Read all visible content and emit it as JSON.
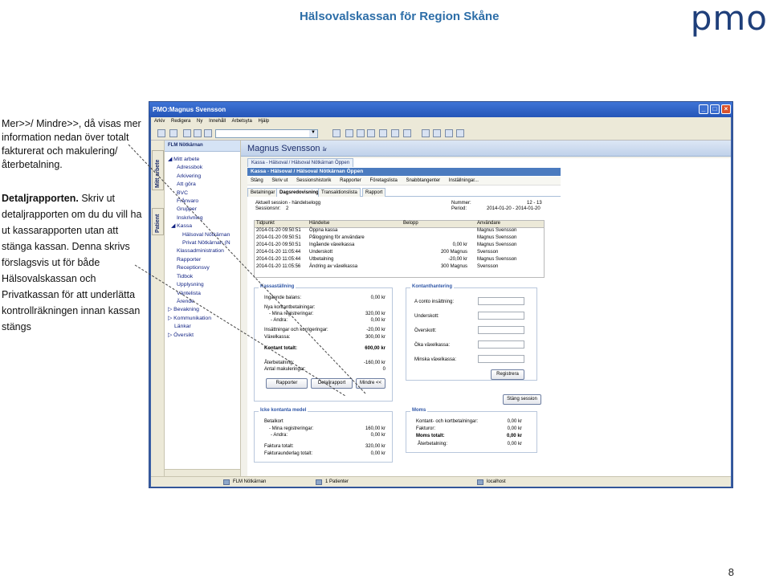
{
  "header": {
    "title": "Hälsovalskassan för Region Skåne",
    "logo": "pmo",
    "page_number": "8"
  },
  "note": {
    "p1": "Mer>>/ Mindre>>, då visas mer information nedan över totalt fakturerat och makulering/återbetalning.",
    "p2_bold": "Detaljrapporten.",
    "p2": " Skriv ut detaljrapporten om du du vill ha ut kassarapporten utan att stänga kassan. Denna skrivs förslagsvis ut för både Hälsovalskassan och Privatkassan för att underlätta kontrollräkningen innan kassan stängs"
  },
  "window": {
    "title": "PMO:Magnus Svensson",
    "menu": [
      "Arkiv",
      "Redigera",
      "Ny",
      "Innehåll",
      "Arbetsyta",
      "Hjälp"
    ],
    "vertical_tabs": [
      "Mitt arbete",
      "Patient"
    ],
    "tree_header": "FLM Nötkärnan",
    "tree": [
      "Mitt arbete",
      "Adressbok",
      "Arkivering",
      "Att göra",
      "BVC",
      "Frånvaro",
      "Grupper",
      "Inskrivning",
      "Kassa",
      "Hälsoval Nötkärnan",
      "Privat Nötkärnan (N",
      "Klassadministration",
      "Rapporter",
      "Receptionsvy",
      "Tidbok",
      "Upplysning",
      "Väntelista",
      "Ärende",
      "Bevakning",
      "Kommunikation",
      "Länkar",
      "Översikt"
    ],
    "patient_name": "Magnus Svensson",
    "patient_suffix": "år",
    "doc_tab": "Kassa - Hälsoval / Hälsoval Nötkärnan Öppen",
    "kassa_bar": "Kassa - Hälsoval / Hälsoval Nötkärnan Öppen",
    "kassa_menu": [
      "Stäng",
      "Skriv ut",
      "Sessionshistorik",
      "Rapporter",
      "Företagslista",
      "Snabbtangenter",
      "Inställningar..."
    ],
    "subtabs": [
      "Betalningar",
      "Dagsredovisning",
      "Transaktionslista",
      "Rapport"
    ],
    "session": {
      "label1": "Aktuell session - händelselogg",
      "label2": "Sessionsnr:",
      "session_nr": "2",
      "nummer_label": "Nummer:",
      "nummer": "12 - 13",
      "period_label": "Period:",
      "period": "2014-01-20 - 2014-01-20"
    },
    "log": {
      "headers": [
        "Tidpunkt",
        "Händelse",
        "Belopp",
        "",
        "Användare"
      ],
      "rows": [
        [
          "2014-01-20 09:50:51",
          "Öppna kassa",
          "",
          "",
          "Magnus Svensson"
        ],
        [
          "2014-01-20 09:50:51",
          "Påloggning för användare",
          "",
          "",
          "Magnus Svensson"
        ],
        [
          "2014-01-20 09:50:51",
          "Ingående växelkassa",
          "",
          "0,00 kr",
          "Magnus Svensson"
        ],
        [
          "2014-01-20 11:05:44",
          "Underskott",
          "",
          "200 Magnus",
          "Svensson"
        ],
        [
          "2014-01-20 11:05:44",
          "Utbetalning",
          "",
          "-20,00 kr",
          "Magnus Svensson"
        ],
        [
          "2014-01-20 11:05:56",
          "Ändring av växelkassa",
          "",
          "300 Magnus",
          "Svensson"
        ]
      ]
    },
    "kassa": {
      "title": "Kassaställning",
      "rows": [
        [
          "Ingående balans:",
          "0,00 kr"
        ],
        [
          "Nya kontantbetalningar:",
          ""
        ],
        [
          "- Mina registreringar:",
          "320,00 kr"
        ],
        [
          "- Andra:",
          "0,00 kr"
        ],
        [
          "Insättningar och korrigeringar:",
          "-20,00 kr"
        ],
        [
          "Växelkassa:",
          "300,00 kr"
        ],
        [
          "Kontant totalt:",
          "600,00 kr"
        ],
        [
          "Återbetalning:",
          "-160,00 kr"
        ],
        [
          "Antal makuleringar:",
          "0"
        ]
      ],
      "buttons": [
        "Rapporter",
        "Detaljrapport",
        "Mindre <<"
      ]
    },
    "kontant": {
      "title": "Kontanthantering",
      "labels": [
        "A conto insättning:",
        "Underskott:",
        "Överskott:",
        "Öka växelkassa:",
        "Minska växelkassa:"
      ],
      "button": "Registrera"
    },
    "stang_button": "Stäng session",
    "ejkontant": {
      "title": "Icke kontanta medel",
      "rows": [
        [
          "Betalkort",
          ""
        ],
        [
          "- Mina registreringar:",
          "160,00 kr"
        ],
        [
          "- Andra:",
          "0,00 kr"
        ],
        [
          "Faktura totalt:",
          "320,00 kr"
        ],
        [
          "Fakturaunderlag totalt:",
          "0,00 kr"
        ]
      ]
    },
    "moms": {
      "title": "Moms",
      "rows": [
        [
          "Kontant- och kortbetalningar:",
          "0,00 kr"
        ],
        [
          "Fakturor:",
          "0,00 kr"
        ],
        [
          "Moms totalt:",
          "0,00 kr"
        ],
        [
          "Återbetalning:",
          "0,00 kr"
        ]
      ]
    },
    "status": {
      "unit": "FLM Nötkärnan",
      "patients": "1 Patienter",
      "host": "localhost"
    }
  }
}
